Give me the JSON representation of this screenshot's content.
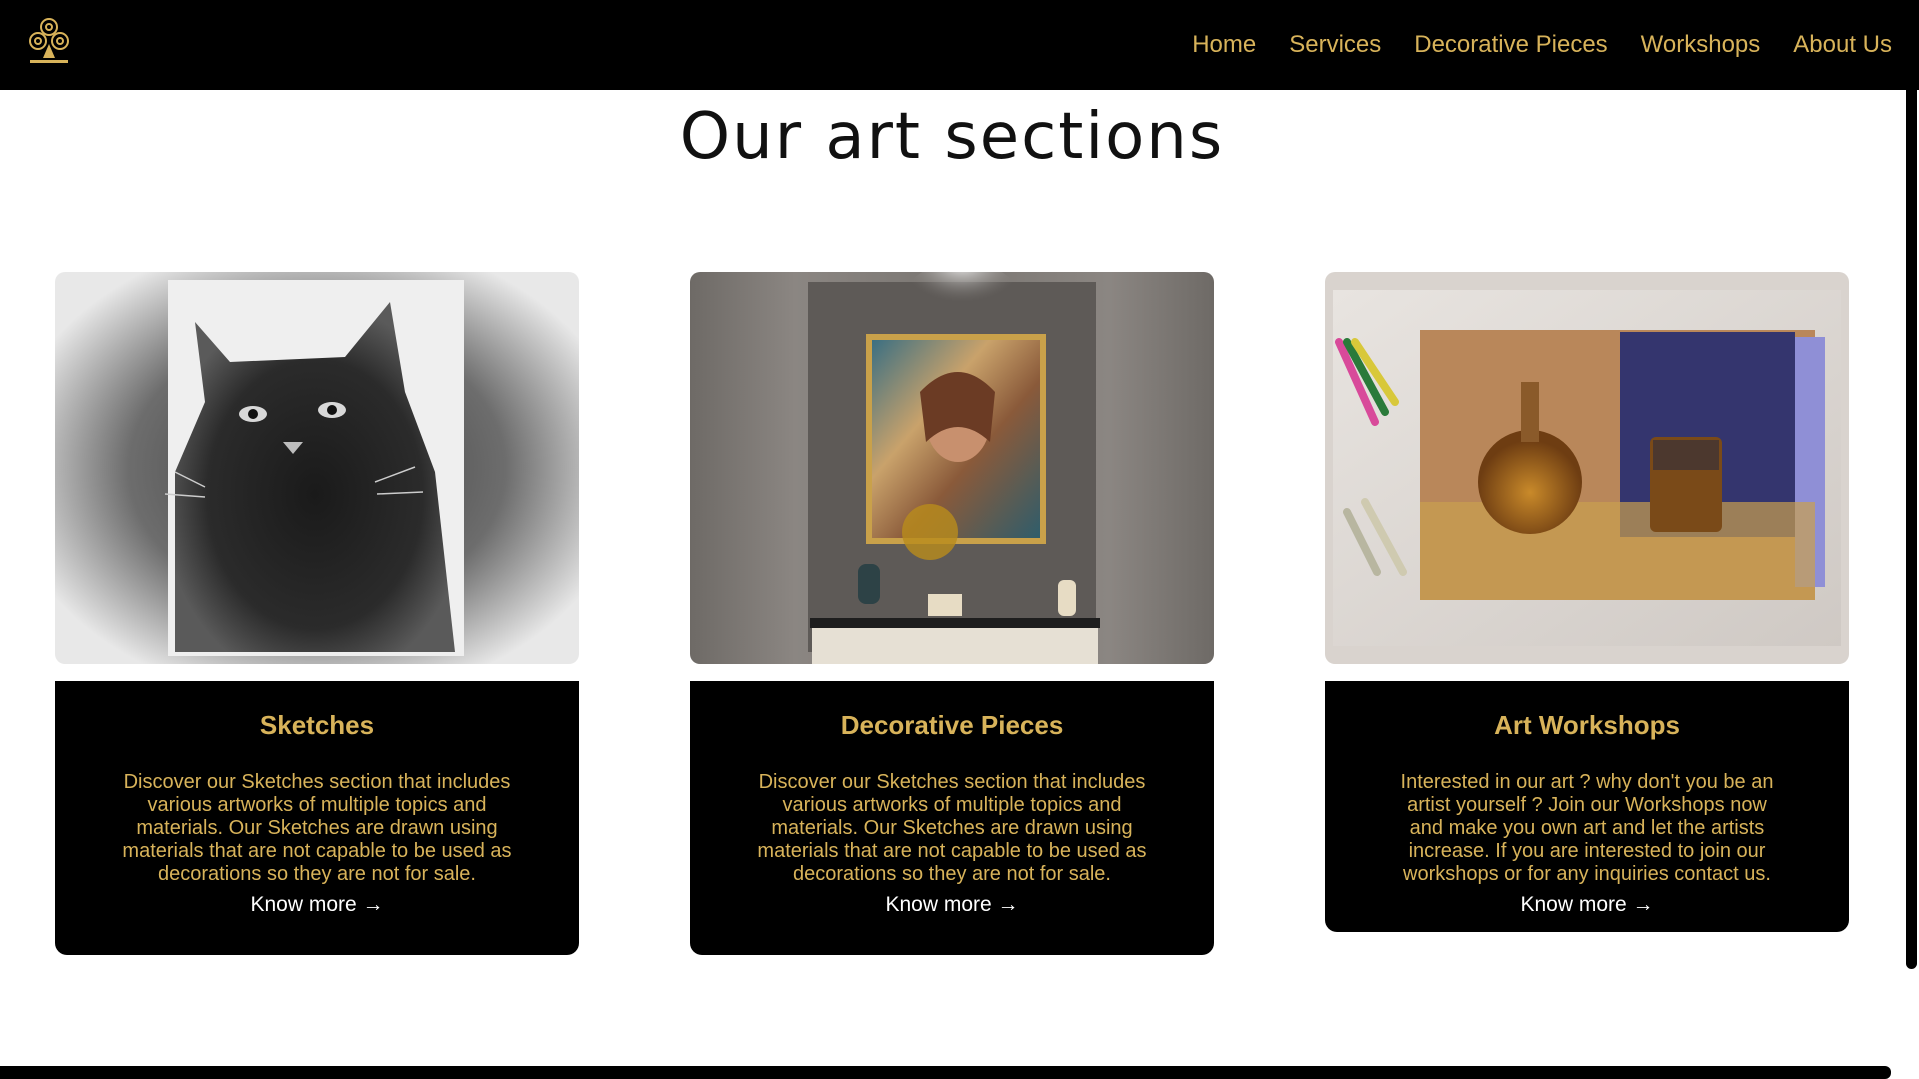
{
  "nav": {
    "logo_icon": "club-emblem-logo",
    "items": [
      {
        "label": "Home"
      },
      {
        "label": "Services"
      },
      {
        "label": "Decorative Pieces"
      },
      {
        "label": "Workshops"
      },
      {
        "label": "About Us"
      }
    ]
  },
  "page": {
    "title": "Our art sections"
  },
  "cards": [
    {
      "image": "charcoal-cat-sketch",
      "title": "Sketches",
      "description": "Discover our Sketches section that includes various artworks of multiple topics and materials. Our Sketches are drawn using materials that are not capable to be used as decorations so they are not for sale.",
      "link": "Know more →"
    },
    {
      "image": "framed-portrait-painting",
      "title": "Decorative Pieces",
      "description": "Discover our Sketches section that includes various artworks of multiple topics and materials. Our Sketches are drawn using materials that are not capable to be used as decorations so they are not for sale.",
      "link": "Know more →"
    },
    {
      "image": "pastel-still-life",
      "title": "Art Workshops",
      "description": "Interested in our art ? why don't you be an artist yourself ? Join our Workshops now and make you own art and let the artists increase. If you are interested to join our workshops or for any inquiries contact us.",
      "link": "Know more →"
    }
  ],
  "colors": {
    "accent_gold": "#d8b35a",
    "header_bg": "#000000",
    "page_bg": "#ffffff"
  }
}
